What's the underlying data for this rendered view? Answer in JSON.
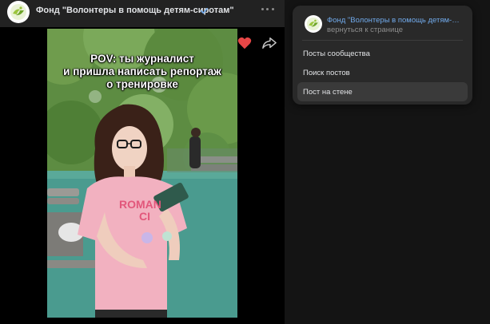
{
  "post": {
    "community_name": "Фонд \"Волонтеры в помощь детям-сиротам\"",
    "verified_icon": "verified-check-icon",
    "more_icon": "more-horizontal-icon",
    "video": {
      "caption_lines": [
        "POV: ты журналист",
        "и пришла написать репортаж",
        "о тренировке"
      ],
      "shirt_text": "ROMAN CI"
    },
    "like_icon": "heart-filled-icon",
    "share_icon": "share-arrow-icon"
  },
  "dropdown": {
    "community_title": "Фонд \"Волонтеры в помощь детям-сиротам\"",
    "back_link": "вернуться к странице",
    "items": [
      {
        "label": "Посты сообщества",
        "active": false
      },
      {
        "label": "Поиск постов",
        "active": false
      },
      {
        "label": "Пост на стене",
        "active": true
      }
    ]
  },
  "colors": {
    "background": "#141414",
    "panel": "#222222",
    "dropdown_bg": "#292929",
    "link_blue": "#71aaeb",
    "like_red": "#e64646",
    "logo_green": "#9bc53d"
  }
}
